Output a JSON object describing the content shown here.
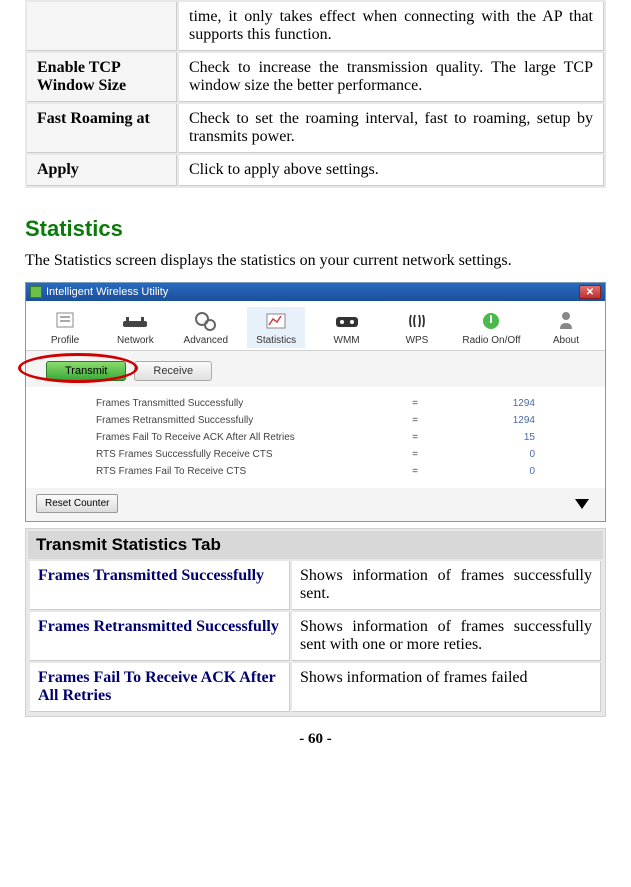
{
  "top_table": {
    "rows": [
      {
        "label": "",
        "desc": "time, it only takes effect when connecting with the AP that supports this function."
      },
      {
        "label": "Enable TCP Window Size",
        "desc": "Check to increase the transmission quality. The large TCP window size the better performance."
      },
      {
        "label": "Fast Roaming at",
        "desc": "Check to set the roaming interval, fast to roaming, setup by transmits power."
      },
      {
        "label": "Apply",
        "desc": "Click to apply above settings."
      }
    ]
  },
  "section": {
    "title": "Statistics",
    "intro": "The Statistics screen displays the statistics on your current network settings."
  },
  "app": {
    "title": "Intelligent Wireless Utility",
    "toolbar": [
      {
        "name": "profile",
        "label": "Profile"
      },
      {
        "name": "network",
        "label": "Network"
      },
      {
        "name": "advanced",
        "label": "Advanced"
      },
      {
        "name": "statistics",
        "label": "Statistics"
      },
      {
        "name": "wmm",
        "label": "WMM"
      },
      {
        "name": "wps",
        "label": "WPS"
      },
      {
        "name": "radio",
        "label": "Radio On/Off"
      },
      {
        "name": "about",
        "label": "About"
      }
    ],
    "tabs": {
      "transmit": "Transmit",
      "receive": "Receive"
    },
    "stats": [
      {
        "label": "Frames Transmitted Successfully",
        "value": "1294"
      },
      {
        "label": "Frames Retransmitted Successfully",
        "value": "1294"
      },
      {
        "label": "Frames Fail To Receive ACK After All Retries",
        "value": "15"
      },
      {
        "label": "RTS Frames Successfully Receive CTS",
        "value": "0"
      },
      {
        "label": "RTS Frames Fail To Receive CTS",
        "value": "0"
      }
    ],
    "reset_label": "Reset Counter"
  },
  "transmit_table": {
    "title": "Transmit Statistics Tab",
    "rows": [
      {
        "label": "Frames Transmitted Successfully",
        "desc": "Shows information of frames successfully sent."
      },
      {
        "label": "Frames Retransmitted Successfully",
        "desc": "Shows information of frames successfully sent with one or more reties."
      },
      {
        "label": "Frames Fail To Receive ACK After All Retries",
        "desc": "Shows information of frames failed"
      }
    ]
  },
  "page_number": "- 60 -"
}
